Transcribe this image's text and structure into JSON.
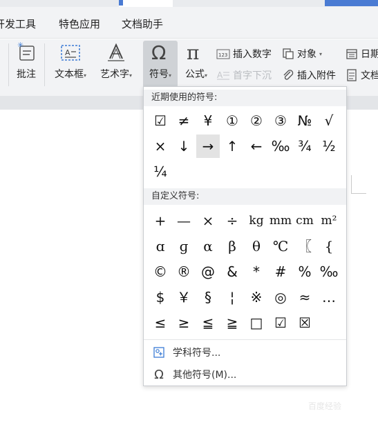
{
  "menu": {
    "tabs": [
      "开发工具",
      "特色应用",
      "文档助手"
    ]
  },
  "ribbon": {
    "buttons": {
      "comment": "批注",
      "textbox": "文本框",
      "wordart": "艺术字",
      "symbol": "符号",
      "formula": "公式"
    },
    "small": {
      "insert_number": "插入数字",
      "object": "对象",
      "date": "日期",
      "drop_cap": "首字下沉",
      "attachment": "插入附件",
      "doc_parts": "文档"
    }
  },
  "symbol_menu": {
    "recent_title": "近期使用的符号:",
    "recent": [
      "☑",
      "≠",
      "¥",
      "①",
      "②",
      "③",
      "№",
      "√",
      "×",
      "↓",
      "→",
      "↑",
      "←",
      "‰",
      "¾",
      "½",
      "¼"
    ],
    "custom_title": "自定义符号:",
    "custom": [
      "+",
      "—",
      "×",
      "÷",
      "kg",
      "mm",
      "cm",
      "m²",
      "ɑ",
      "ɡ",
      "α",
      "β",
      "θ",
      "℃",
      "〖",
      "{",
      "©",
      "®",
      "@",
      "&",
      "*",
      "#",
      "%",
      "‰",
      "$",
      "￥",
      "§",
      "¦",
      "※",
      "◎",
      "≈",
      "…",
      "≤",
      "≥",
      "≦",
      "≧",
      "□",
      "☑",
      "☒"
    ],
    "subject_symbols": "学科符号...",
    "other_symbols": "其他符号(M)..."
  },
  "watermark": "百度经验"
}
